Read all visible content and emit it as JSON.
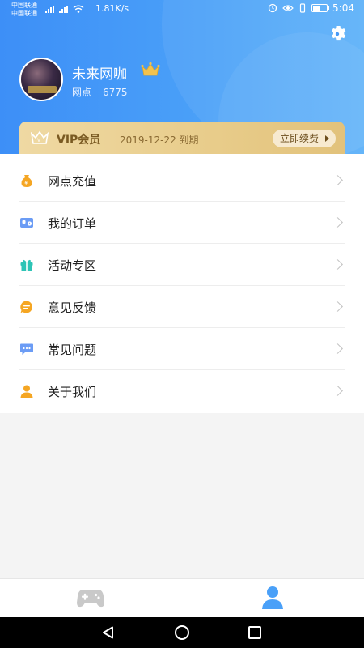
{
  "status_bar": {
    "carrier1": "中国联通",
    "carrier2": "中国联通",
    "network_speed": "1.81K/s",
    "time": "5:04"
  },
  "profile": {
    "username": "未来网咖",
    "points_label": "网点",
    "points_value": "6775"
  },
  "vip": {
    "title": "VIP会员",
    "expiry": "2019-12-22 到期",
    "renew_label": "立即续费"
  },
  "menu": {
    "items": [
      {
        "label": "网点充值",
        "icon": "money-bag-icon"
      },
      {
        "label": "我的订单",
        "icon": "order-card-icon"
      },
      {
        "label": "活动专区",
        "icon": "gift-icon"
      },
      {
        "label": "意见反馈",
        "icon": "feedback-bubble-icon"
      },
      {
        "label": "常见问题",
        "icon": "chat-dots-icon"
      },
      {
        "label": "关于我们",
        "icon": "person-icon"
      }
    ]
  },
  "tabs": {
    "items": [
      {
        "name": "games",
        "icon": "gamepad-icon"
      },
      {
        "name": "profile",
        "icon": "user-icon"
      }
    ]
  },
  "colors": {
    "header_blue": "#3d8ff7",
    "vip_gold": "#e8cc8a",
    "money": "#f5a623",
    "order": "#6b9cf5",
    "gift": "#2ec4b6",
    "feedback": "#f5a623",
    "faq": "#6b9cf5",
    "about": "#f5a623",
    "tab_active": "#4aa0f8",
    "tab_inactive": "#c9c9c9"
  }
}
